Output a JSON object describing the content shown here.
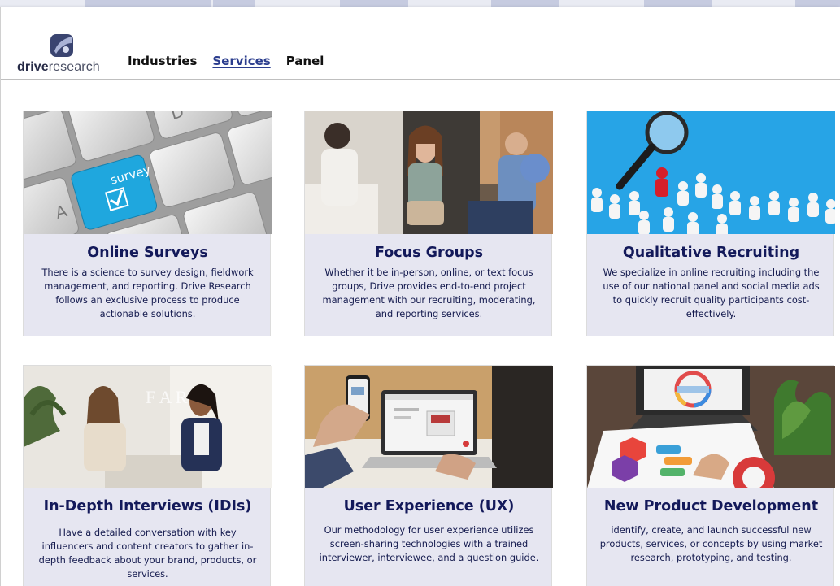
{
  "brand": {
    "name_bold": "drive",
    "name_rest": "research",
    "mark_icon": "drive-research-logo-icon",
    "colors": {
      "mark": "#3a4470",
      "mark_light": "#aab3d6"
    }
  },
  "nav": {
    "items": [
      {
        "label": "Industries",
        "active": false
      },
      {
        "label": "Services",
        "active": true
      },
      {
        "label": "Panel",
        "active": false
      }
    ]
  },
  "colors": {
    "card_bg": "#e6e6f1",
    "card_title": "#13195a",
    "card_text": "#141a4e",
    "nav_active": "#2b3d8e"
  },
  "services": [
    {
      "title": "Online Surveys",
      "description": "There is a science to survey design, fieldwork management, and reporting. Drive Research follows an exclusive process to produce actionable solutions.",
      "image_icon": "keyboard-survey-key-image",
      "key_label": "survey"
    },
    {
      "title": "Focus Groups",
      "description": "Whether it be in-person, online, or text focus groups, Drive provides end-to-end project management with our recruiting, moderating, and reporting services.",
      "image_icon": "focus-group-people-image"
    },
    {
      "title": "Qualitative Recruiting",
      "description": "We specialize in online recruiting including the use of our national panel and social media ads to quickly recruit quality participants cost-effectively.",
      "image_icon": "magnifier-figures-image"
    },
    {
      "title": "In-Depth Interviews (IDIs)",
      "description": "Have a detailed conversation with key influencers and content creators to gather in-depth feedback about your brand, products, or services.",
      "image_icon": "interview-two-women-image"
    },
    {
      "title": "User Experience (UX)",
      "description": "Our methodology for user experience utilizes screen-sharing technologies with a trained interviewer, interviewee, and a question guide.",
      "image_icon": "laptop-phone-ux-image"
    },
    {
      "title": "New Product Development",
      "description": "identify, create, and launch successful new products, services, or concepts by using market research, prototyping, and testing.",
      "image_icon": "product-planning-desk-image"
    }
  ]
}
